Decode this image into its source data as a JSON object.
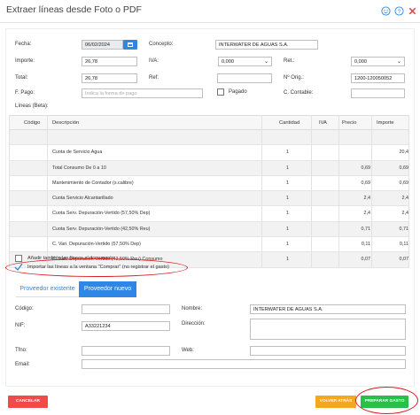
{
  "window": {
    "title": "Extraer líneas desde Foto o PDF"
  },
  "form": {
    "fecha_label": "Fecha:",
    "fecha_value": "06/02/2024",
    "concepto_label": "Concepto:",
    "concepto_value": "INTERWATER DE AGUAS S.A.",
    "importe_label": "Importe:",
    "importe_value": "26,78",
    "iva_label": "IVA:",
    "iva_value": "0,000",
    "ret_label": "Ret.:",
    "ret_value": "0,000",
    "total_label": "Total:",
    "total_value": "26,78",
    "ref_label": "Ref:",
    "ref_value": "",
    "norig_label": "Nº Orig.:",
    "norig_value": "1200-120050052",
    "fpago_label": "F. Pago:",
    "fpago_placeholder": "Indica la forma de pago",
    "pagado_label": "Pagado",
    "contable_label": "C. Contable:",
    "contable_value": ""
  },
  "lines": {
    "section_label": "Líneas (Beta):",
    "headers": [
      "Código",
      "Descripción",
      "Cantidad",
      "IVA",
      "Precio",
      "Importe"
    ],
    "rows": [
      [
        "",
        "",
        "",
        "",
        "",
        ""
      ],
      [
        "",
        "Cuota de Servicio Agua",
        "1",
        "",
        "",
        "20,4"
      ],
      [
        "",
        "Total Consumo De 0 a 10",
        "1",
        "",
        "0,69",
        "0,69"
      ],
      [
        "",
        "Mantenimiento de Contador (s.calibre)",
        "1",
        "",
        "0,69",
        "0,69"
      ],
      [
        "",
        "Cuota Servicio Alcantarillado",
        "1",
        "",
        "2,4",
        "2,4"
      ],
      [
        "",
        "Cuota Serv. Depuración-Vertido (57,50% Dep)",
        "1",
        "",
        "2,4",
        "2,4"
      ],
      [
        "",
        "Cuota Serv. Depuración-Vertido (42,50% Reu)",
        "1",
        "",
        "0,71",
        "0,71"
      ],
      [
        "",
        "C. Vari. Depuración-Vertido (57,50% Dep)",
        "1",
        "",
        "0,11",
        "0,11"
      ],
      [
        "",
        "C. Vari. Depuración-Vertido (42,50% Reu) Consumo",
        "1",
        "",
        "0,07",
        "0,07"
      ]
    ]
  },
  "options": {
    "add_lines_label": "Añadir también las líneas al documento",
    "import_label": "Importar las líneas a la ventana \"Comprar\" (no registrar el gasto)"
  },
  "tabs": {
    "existing": "Proveedor existente",
    "new": "Proveedor nuevo"
  },
  "provider": {
    "codigo_label": "Código:",
    "codigo_value": "",
    "nombre_label": "Nombre:",
    "nombre_value": "INTERWATER DE AGUAS S.A.",
    "nif_label": "NIF:",
    "nif_value": "A33221234",
    "direccion_label": "Dirección:",
    "direccion_value": "",
    "tfno_label": "Tfno:",
    "tfno_value": "",
    "web_label": "Web:",
    "web_value": "",
    "email_label": "Email:",
    "email_value": ""
  },
  "buttons": {
    "cancel": "CANCELAR",
    "back": "VOLVER ATRÁS",
    "prepare": "PREPARAR GASTO"
  },
  "colors": {
    "primary": "#2f86e5",
    "danger": "#f04a4a",
    "warning": "#f5a623",
    "success": "#28c04a",
    "annotation": "#d42020"
  },
  "icons": [
    "smile-icon",
    "help-icon",
    "close-icon",
    "calendar-icon",
    "chevron-down-icon",
    "checkmark-icon"
  ]
}
